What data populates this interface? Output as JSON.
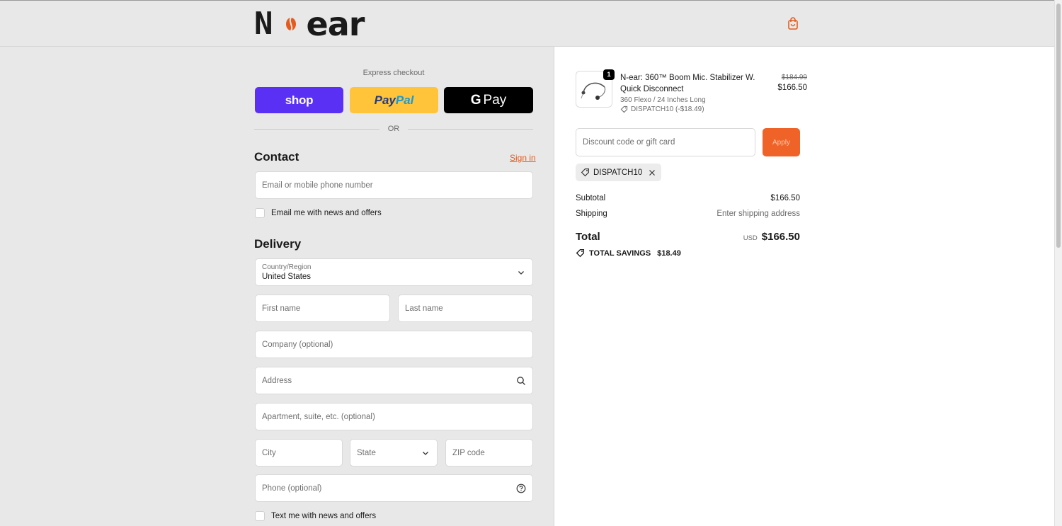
{
  "header": {
    "logo_left": "N",
    "logo_right": "ear"
  },
  "express": {
    "title": "Express checkout",
    "shop_label": "shop",
    "paypal_a": "Pay",
    "paypal_b": "Pal",
    "gpay_g": "G",
    "gpay_label": "Pay",
    "or": "OR"
  },
  "contact": {
    "heading": "Contact",
    "signin": "Sign in",
    "email_placeholder": "Email or mobile phone number",
    "news_label": "Email me with news and offers"
  },
  "delivery": {
    "heading": "Delivery",
    "country_label": "Country/Region",
    "country_value": "United States",
    "first_name": "First name",
    "last_name": "Last name",
    "company": "Company (optional)",
    "address": "Address",
    "apartment": "Apartment, suite, etc. (optional)",
    "city": "City",
    "state": "State",
    "zip": "ZIP code",
    "phone": "Phone (optional)",
    "text_label": "Text me with news and offers"
  },
  "order": {
    "quantity": "1",
    "product_title": "N-ear: 360™ Boom Mic. Stabilizer W. Quick Disconnect",
    "variant": "360 Flexo / 24 Inches Long",
    "discount_line": "DISPATCH10 (-$18.49)",
    "original_price": "$184.99",
    "price": "$166.50",
    "discount_placeholder": "Discount code or gift card",
    "apply": "Apply",
    "applied_code": "DISPATCH10",
    "subtotal_label": "Subtotal",
    "subtotal_value": "$166.50",
    "shipping_label": "Shipping",
    "shipping_value": "Enter shipping address",
    "total_label": "Total",
    "currency": "USD",
    "total_value": "$166.50",
    "savings_label": "TOTAL SAVINGS",
    "savings_value": "$18.49"
  },
  "colors": {
    "accent": "#f06328",
    "shop": "#5a31f4",
    "paypal": "#ffc439",
    "gpay": "#000000"
  }
}
